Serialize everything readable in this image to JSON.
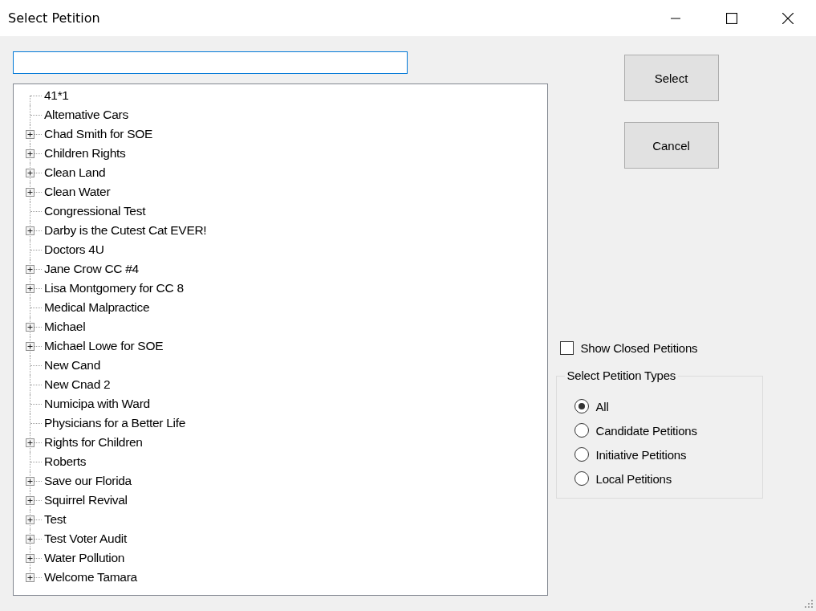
{
  "window": {
    "title": "Select Petition"
  },
  "tree": {
    "items": [
      {
        "label": "41*1",
        "kind": "leaf"
      },
      {
        "label": "Altemative Cars",
        "kind": "leaf"
      },
      {
        "label": "Chad Smith for SOE",
        "kind": "parent"
      },
      {
        "label": "Children Rights",
        "kind": "parent"
      },
      {
        "label": "Clean Land",
        "kind": "parent"
      },
      {
        "label": "Clean Water",
        "kind": "parent"
      },
      {
        "label": "Congressional Test",
        "kind": "leaf"
      },
      {
        "label": "Darby is the Cutest Cat EVER!",
        "kind": "parent"
      },
      {
        "label": "Doctors 4U",
        "kind": "leaf"
      },
      {
        "label": "Jane Crow CC #4",
        "kind": "parent"
      },
      {
        "label": "Lisa Montgomery for CC 8",
        "kind": "parent"
      },
      {
        "label": "Medical Malpractice",
        "kind": "leaf"
      },
      {
        "label": "Michael",
        "kind": "parent"
      },
      {
        "label": "Michael Lowe for SOE",
        "kind": "parent"
      },
      {
        "label": "New Cand",
        "kind": "leaf"
      },
      {
        "label": "New Cnad 2",
        "kind": "leaf"
      },
      {
        "label": "Numicipa with Ward",
        "kind": "leaf"
      },
      {
        "label": "Physicians for a Better Life",
        "kind": "leaf"
      },
      {
        "label": "Rights for Children",
        "kind": "parent"
      },
      {
        "label": "Roberts",
        "kind": "leaf"
      },
      {
        "label": "Save our Florida",
        "kind": "parent"
      },
      {
        "label": "Squirrel Revival",
        "kind": "parent"
      },
      {
        "label": "Test",
        "kind": "parent"
      },
      {
        "label": "Test Voter Audit",
        "kind": "parent"
      },
      {
        "label": "Water Pollution",
        "kind": "parent"
      },
      {
        "label": "Welcome Tamara",
        "kind": "parent"
      }
    ]
  },
  "buttons": [
    "Select",
    "Cancel"
  ],
  "show_closed": {
    "label": "Show Closed Petitions",
    "checked": false
  },
  "petition_types": {
    "title": "Select Petition Types",
    "options": [
      {
        "label": "All",
        "selected": true
      },
      {
        "label": "Candidate Petitions",
        "selected": false
      },
      {
        "label": "Initiative Petitions",
        "selected": false
      },
      {
        "label": "Local Petitions",
        "selected": false
      }
    ]
  }
}
